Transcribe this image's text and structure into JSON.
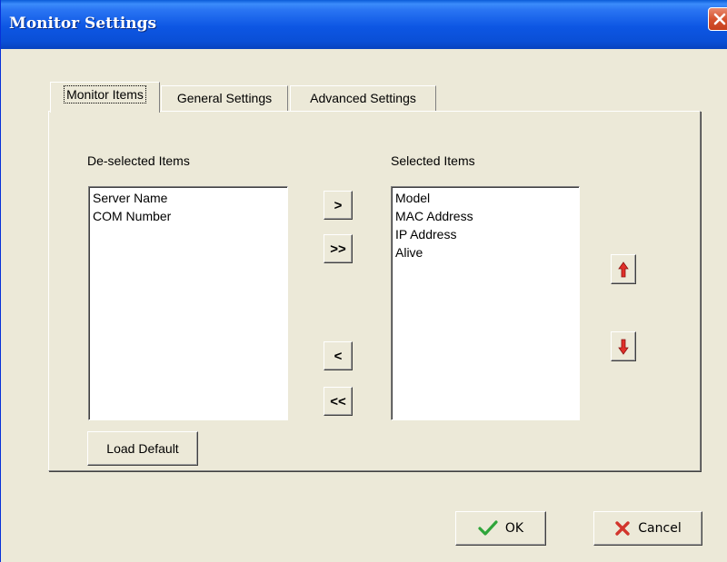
{
  "window": {
    "title": "Monitor Settings"
  },
  "tabs": [
    {
      "label": "Monitor Items",
      "active": true
    },
    {
      "label": "General Settings",
      "active": false
    },
    {
      "label": "Advanced Settings",
      "active": false
    }
  ],
  "deselected": {
    "label": "De-selected Items",
    "items": [
      "Server Name",
      "COM Number"
    ]
  },
  "selected": {
    "label": "Selected Items",
    "items": [
      "Model",
      "MAC Address",
      "IP Address",
      "Alive"
    ]
  },
  "transfer_buttons": {
    "add": ">",
    "add_all": ">>",
    "remove": "<",
    "remove_all": "<<"
  },
  "load_default_label": "Load Default",
  "footer": {
    "ok_label": "OK",
    "cancel_label": "Cancel"
  },
  "colors": {
    "accent_title": "#0A4FD6",
    "arrow_red": "#E0302A",
    "ok_check_green": "#2FA53A",
    "cancel_x_red": "#D2352C"
  }
}
